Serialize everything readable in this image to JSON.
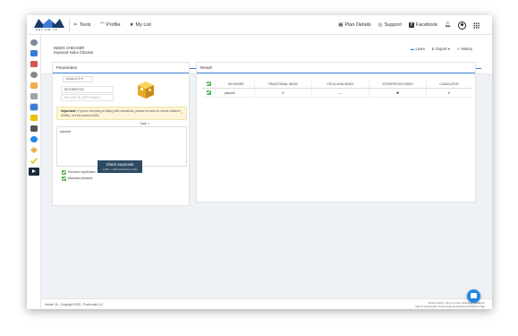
{
  "nav": {
    "brand": "HELIUM 10",
    "links": [
      {
        "label": "Tools",
        "icon": "tools-icon"
      },
      {
        "label": "Profile",
        "icon": "profile-icon"
      },
      {
        "label": "My List",
        "icon": "star-icon"
      }
    ],
    "right": [
      {
        "label": "Plan Details",
        "icon": "plan-icon"
      },
      {
        "label": "Support",
        "icon": "support-icon"
      },
      {
        "label": "Facebook",
        "icon": "facebook-icon"
      }
    ]
  },
  "sidebar": {
    "items": [
      {
        "name": "sidebar-item-1",
        "color": "#7a8a9a"
      },
      {
        "name": "sidebar-item-2",
        "color": "#3a7bd5"
      },
      {
        "name": "sidebar-item-3",
        "color": "#d9534f"
      },
      {
        "name": "sidebar-item-4",
        "color": "#888888"
      },
      {
        "name": "sidebar-item-5",
        "color": "#f0ad4e"
      },
      {
        "name": "sidebar-item-6",
        "color": "#9aa5b1"
      },
      {
        "name": "sidebar-item-7",
        "color": "#3a7bd5"
      },
      {
        "name": "sidebar-item-8",
        "color": "#e6c200"
      },
      {
        "name": "sidebar-item-9",
        "color": "#555555"
      },
      {
        "name": "sidebar-item-10",
        "color": "#1e88e5"
      },
      {
        "name": "sidebar-item-11",
        "color": "#f0ad4e"
      },
      {
        "name": "sidebar-item-12",
        "color": "#e6c200"
      },
      {
        "name": "sidebar-item-13",
        "color": "#1d2a3a"
      }
    ]
  },
  "header": {
    "title": "INDEX CHECKER",
    "subtitle": "Keyword Index Checker",
    "actions": [
      {
        "label": "Learn",
        "icon": "learn-icon"
      },
      {
        "label": "Export",
        "icon": "export-icon"
      },
      {
        "label": "History",
        "icon": "history-icon"
      }
    ]
  },
  "params": {
    "title": "Parameters",
    "marketplace": "amazon.fr",
    "asin": "B0T0N9FD32",
    "seller_placeholder": "SELLER ID (OPTIONAL)",
    "warning_bold": "Important:",
    "warning_text": "If you're checking a listing with variations, please be sure to check children ASINs, not the parent ASIN.",
    "total_label": "Total: 1",
    "keywords_text": "planche",
    "opt1": "Remove duplicates",
    "opt2": "Maintain phrases",
    "cta_label": "Check keywords",
    "cta_sub": "1,000 / 1,000 Characters Max"
  },
  "result": {
    "title": "Result",
    "columns": [
      "KEYWORD",
      "TRADITIONAL INDEX",
      "FIELD-ASIN INDEX",
      "STOREFRONT INDEX",
      "CUMULATIVE"
    ],
    "rows": [
      {
        "keyword": "planche",
        "traditional": "✔",
        "field_asin": "—",
        "storefront": "✖",
        "cumulative": "✔"
      }
    ]
  },
  "footer": {
    "left": "Helium 10 - Copyright 2019 - Pixelcrafts LLC",
    "right1": "Privacy Policy | Terms of Use | Earnings Disclaimer",
    "right2": "Submit Testimonial | Testimonials and Results Disclaimer Page"
  }
}
